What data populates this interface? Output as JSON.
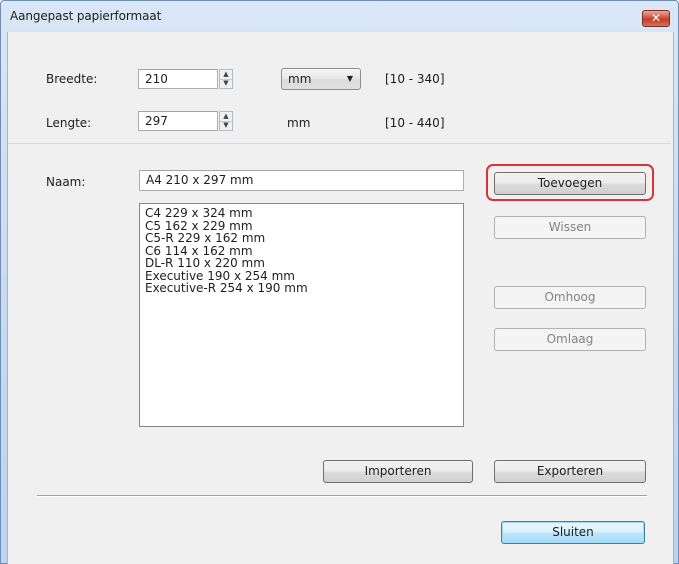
{
  "window": {
    "title": "Aangepast papierformaat",
    "close_glyph": "✕"
  },
  "width": {
    "label": "Breedte:",
    "value": "210",
    "unit": "mm",
    "range": "[10 - 340]"
  },
  "length": {
    "label": "Lengte:",
    "value": "297",
    "unit": "mm",
    "range": "[10 - 440]"
  },
  "name": {
    "label": "Naam:",
    "value": "A4 210 x 297 mm"
  },
  "formats": [
    "C4 229 x 324 mm",
    "C5 162 x 229 mm",
    "C5-R 229 x 162 mm",
    "C6 114 x 162 mm",
    "DL-R 110 x 220 mm",
    "Executive 190 x 254 mm",
    "Executive-R 254 x 190 mm"
  ],
  "buttons": {
    "add": "Toevoegen",
    "delete": "Wissen",
    "up": "Omhoog",
    "down": "Omlaag",
    "import": "Importeren",
    "export": "Exporteren",
    "close": "Sluiten"
  },
  "colors": {
    "highlight": "#d9333a",
    "default_button": "#3c7fb1",
    "titlebar": "#c5d9f0",
    "close_button": "#c23a24"
  },
  "icons": {
    "spinner_up": "▲",
    "spinner_down": "▼",
    "dropdown": "▼"
  }
}
